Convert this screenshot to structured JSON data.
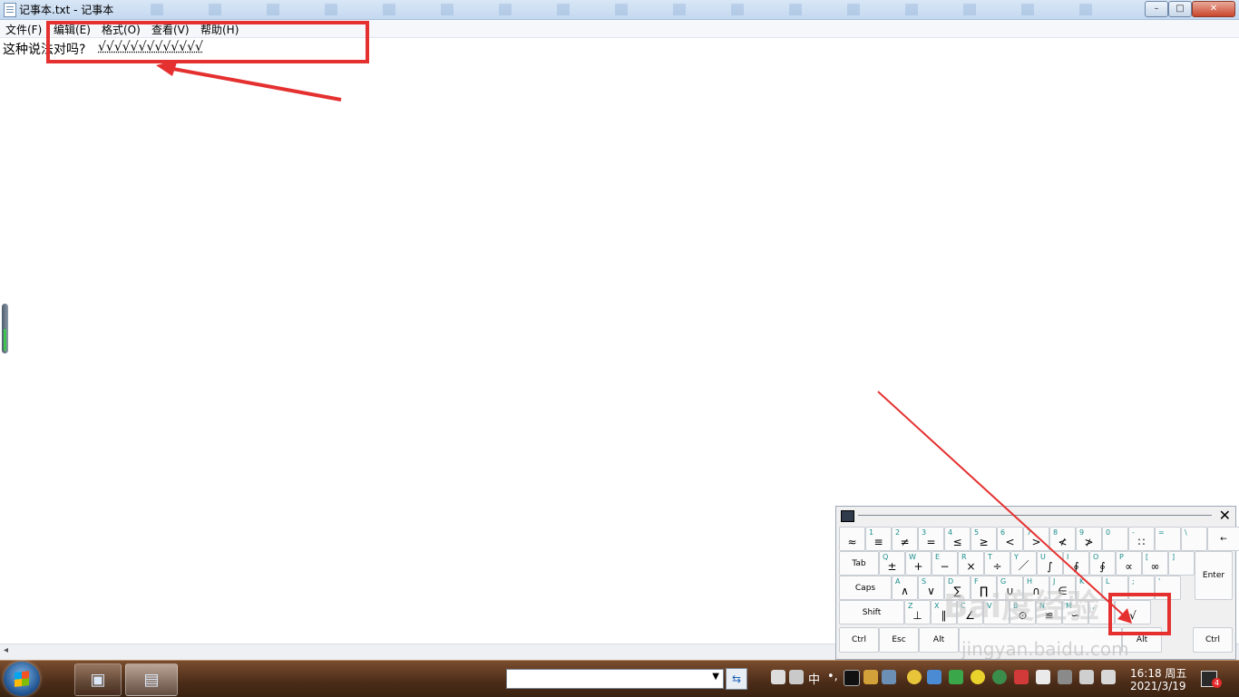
{
  "window": {
    "title": "记事本.txt - 记事本",
    "minimize_glyph": "–",
    "maximize_glyph": "□",
    "close_glyph": "✕"
  },
  "menu": [
    "文件(F)",
    "编辑(E)",
    "格式(O)",
    "查看(V)",
    "帮助(H)"
  ],
  "editor": {
    "text": "这种说法对吗?",
    "marks": "√√√√√√√√√√√√√"
  },
  "osk": {
    "close_glyph": "✕",
    "row1": [
      {
        "top": "",
        "bottom": "≈"
      },
      {
        "top": "1",
        "bottom": "≡"
      },
      {
        "top": "2",
        "bottom": "≠"
      },
      {
        "top": "3",
        "bottom": "="
      },
      {
        "top": "4",
        "bottom": "≤"
      },
      {
        "top": "5",
        "bottom": "≥"
      },
      {
        "top": "6",
        "bottom": "<"
      },
      {
        "top": "7",
        "bottom": ">"
      },
      {
        "top": "8",
        "bottom": "≮"
      },
      {
        "top": "9",
        "bottom": "≯"
      },
      {
        "top": "0",
        "bottom": ""
      },
      {
        "top": "-",
        "bottom": "∷"
      },
      {
        "top": "=",
        "bottom": ""
      },
      {
        "top": "\\",
        "bottom": ""
      },
      {
        "top": "",
        "bottom": "←"
      }
    ],
    "row2": [
      {
        "top": "",
        "bottom": "Tab"
      },
      {
        "top": "Q",
        "bottom": "±"
      },
      {
        "top": "W",
        "bottom": "+"
      },
      {
        "top": "E",
        "bottom": "−"
      },
      {
        "top": "R",
        "bottom": "×"
      },
      {
        "top": "T",
        "bottom": "÷"
      },
      {
        "top": "Y",
        "bottom": "／"
      },
      {
        "top": "U",
        "bottom": "∫"
      },
      {
        "top": "I",
        "bottom": "∮"
      },
      {
        "top": "O",
        "bottom": "∮"
      },
      {
        "top": "P",
        "bottom": "∝"
      },
      {
        "top": "[",
        "bottom": "∞"
      },
      {
        "top": "]",
        "bottom": ""
      }
    ],
    "row3": [
      {
        "top": "",
        "bottom": "Caps"
      },
      {
        "top": "A",
        "bottom": "∧"
      },
      {
        "top": "S",
        "bottom": "∨"
      },
      {
        "top": "D",
        "bottom": "∑"
      },
      {
        "top": "F",
        "bottom": "∏"
      },
      {
        "top": "G",
        "bottom": "∪"
      },
      {
        "top": "H",
        "bottom": "∩"
      },
      {
        "top": "J",
        "bottom": "∈"
      },
      {
        "top": "K",
        "bottom": ""
      },
      {
        "top": "L",
        "bottom": ""
      },
      {
        "top": ";",
        "bottom": ""
      },
      {
        "top": "'",
        "bottom": ""
      }
    ],
    "row4": [
      {
        "top": "",
        "bottom": "Shift"
      },
      {
        "top": "Z",
        "bottom": "⊥"
      },
      {
        "top": "X",
        "bottom": "∥"
      },
      {
        "top": "C",
        "bottom": "∠"
      },
      {
        "top": "V",
        "bottom": ""
      },
      {
        "top": "B",
        "bottom": "⊙"
      },
      {
        "top": "N",
        "bottom": "≌"
      },
      {
        "top": "M",
        "bottom": "∽"
      },
      {
        "top": ",",
        "bottom": ""
      },
      {
        "top": "",
        "bottom": "√"
      }
    ],
    "row5": [
      "Ctrl",
      "Esc",
      "Alt",
      "",
      "Alt",
      "Ctrl"
    ],
    "enter": "Enter"
  },
  "watermark": {
    "text": "Bai度经验",
    "url": "jingyan.baidu.com"
  },
  "taskbar": {
    "ime": "中",
    "ime_dot": "•,",
    "time": "16:18 周五",
    "date": "2021/3/19",
    "notifications": "4",
    "go_glyph": "⇆",
    "dropdown_glyph": "▼"
  },
  "annotations": {
    "color": "#e53030"
  }
}
